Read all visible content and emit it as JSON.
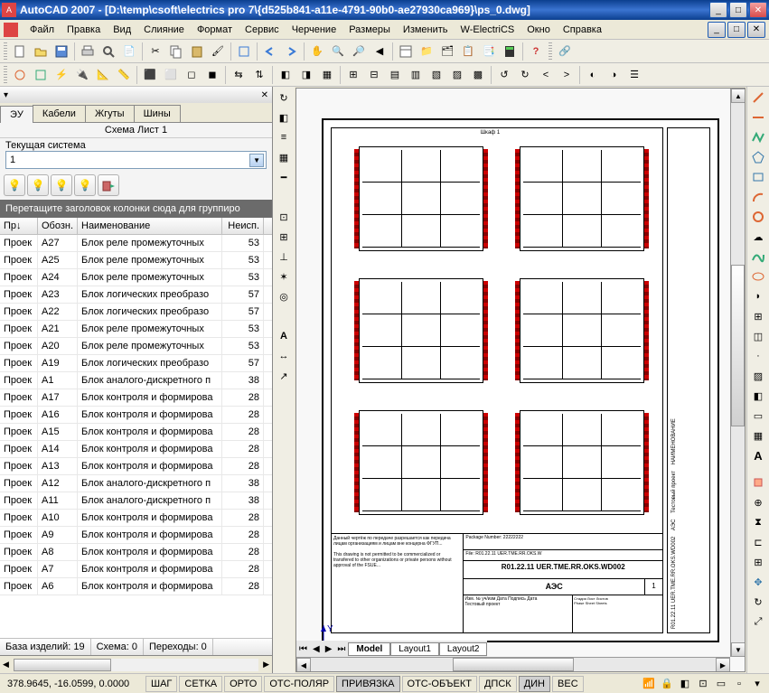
{
  "title": "AutoCAD 2007 - [D:\\temp\\csoft\\electrics pro 7\\{d525b841-a11e-4791-90b0-ae27930ca969}\\ps_0.dwg]",
  "menu": [
    "Файл",
    "Правка",
    "Вид",
    "Слияние",
    "Формат",
    "Сервис",
    "Черчение",
    "Размеры",
    "Изменить",
    "W-ElectriCS",
    "Окно",
    "Справка"
  ],
  "left": {
    "tabs": [
      "ЭУ",
      "Кабели",
      "Жгуты",
      "Шины"
    ],
    "schemaSheet": "Схема  Лист 1",
    "currentSystemLabel": "Текущая система",
    "currentSystemValue": "1",
    "groupHint": "Перетащите заголовок колонки сюда для группиро",
    "columns": [
      "Пр↓",
      "Обозн.",
      "Наименование",
      "Неисп."
    ],
    "rows": [
      {
        "p": "Проек",
        "o": "A27",
        "n": "Блок реле промежуточных",
        "u": "53"
      },
      {
        "p": "Проек",
        "o": "A25",
        "n": "Блок реле промежуточных",
        "u": "53"
      },
      {
        "p": "Проек",
        "o": "A24",
        "n": "Блок реле промежуточных",
        "u": "53"
      },
      {
        "p": "Проек",
        "o": "A23",
        "n": "Блок логических преобразо",
        "u": "57"
      },
      {
        "p": "Проек",
        "o": "A22",
        "n": "Блок логических преобразо",
        "u": "57"
      },
      {
        "p": "Проек",
        "o": "A21",
        "n": "Блок реле промежуточных",
        "u": "53"
      },
      {
        "p": "Проек",
        "o": "A20",
        "n": "Блок реле промежуточных",
        "u": "53"
      },
      {
        "p": "Проек",
        "o": "A19",
        "n": "Блок логических преобразо",
        "u": "57"
      },
      {
        "p": "Проек",
        "o": "A1",
        "n": "Блок аналого-дискретного п",
        "u": "38"
      },
      {
        "p": "Проек",
        "o": "A17",
        "n": "Блок контроля и формирова",
        "u": "28"
      },
      {
        "p": "Проек",
        "o": "A16",
        "n": "Блок контроля и формирова",
        "u": "28"
      },
      {
        "p": "Проек",
        "o": "A15",
        "n": "Блок контроля и формирова",
        "u": "28"
      },
      {
        "p": "Проек",
        "o": "A14",
        "n": "Блок контроля и формирова",
        "u": "28"
      },
      {
        "p": "Проек",
        "o": "A13",
        "n": "Блок контроля и формирова",
        "u": "28"
      },
      {
        "p": "Проек",
        "o": "A12",
        "n": "Блок аналого-дискретного п",
        "u": "38"
      },
      {
        "p": "Проек",
        "o": "A11",
        "n": "Блок аналого-дискретного п",
        "u": "38"
      },
      {
        "p": "Проек",
        "o": "A10",
        "n": "Блок контроля и формирова",
        "u": "28"
      },
      {
        "p": "Проек",
        "o": "A9",
        "n": "Блок контроля и формирова",
        "u": "28"
      },
      {
        "p": "Проек",
        "o": "A8",
        "n": "Блок контроля и формирова",
        "u": "28"
      },
      {
        "p": "Проек",
        "o": "A7",
        "n": "Блок контроля и формирова",
        "u": "28"
      },
      {
        "p": "Проек",
        "o": "A6",
        "n": "Блок контроля и формирова",
        "u": "28"
      }
    ],
    "footer": {
      "baza": "База изделий: 19",
      "schema": "Схема: 0",
      "perehody": "Переходы: 0"
    }
  },
  "drawing": {
    "sheetTitle": "Шкаф 1",
    "pkgNum": "Package Number:   22222222",
    "fileLine": "File: R01.22.11  UER.TME.RR.OKS.W",
    "code": "R01.22.11  UER.TME.RR.OKS.WD002",
    "org": "АЭС",
    "rev": "1",
    "project": "Тестовый проект"
  },
  "layoutTabs": [
    "Model",
    "Layout1",
    "Layout2"
  ],
  "status": {
    "coords": "378.9645, -16.0599, 0.0000",
    "buttons": [
      "ШАГ",
      "СЕТКА",
      "ОРТО",
      "ОТС-ПОЛЯР",
      "ПРИВЯЗКА",
      "ОТС-ОБЪЕКТ",
      "ДПСК",
      "ДИН",
      "ВЕС"
    ]
  }
}
